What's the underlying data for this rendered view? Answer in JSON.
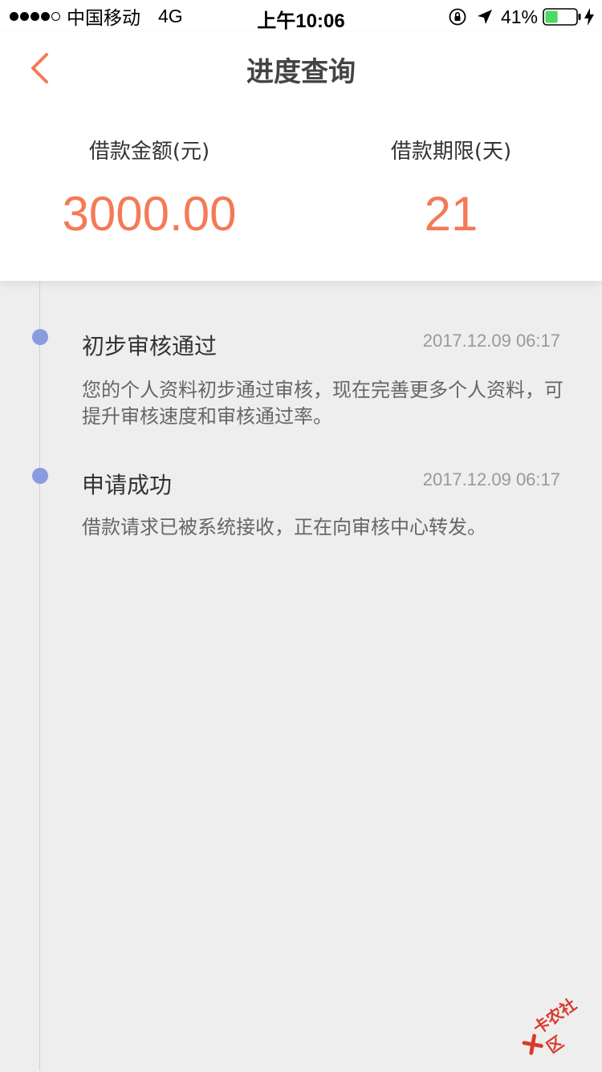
{
  "status_bar": {
    "carrier": "中国移动",
    "network": "4G",
    "time": "上午10:06",
    "battery_percent": "41%",
    "battery_level": 0.41,
    "signal_bars_filled": 4,
    "signal_bars_total": 5
  },
  "header": {
    "title": "进度查询",
    "back_icon": "chevron-left-icon",
    "accent_color": "#f47a56"
  },
  "summary": {
    "amount_label": "借款金额(元)",
    "amount_value": "3000.00",
    "term_label": "借款期限(天)",
    "term_value": "21"
  },
  "timeline": {
    "dot_color": "#8a9be0",
    "events": [
      {
        "title": "初步审核通过",
        "time": "2017.12.09 06:17",
        "description": "您的个人资料初步通过审核，现在完善更多个人资料，可提升审核速度和审核通过率。"
      },
      {
        "title": "申请成功",
        "time": "2017.12.09 06:17",
        "description": "借款请求已被系统接收，正在向审核中心转发。"
      }
    ]
  },
  "watermark": {
    "text": "卡农社区"
  }
}
